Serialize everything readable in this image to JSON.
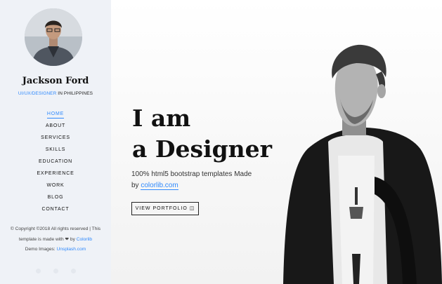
{
  "sidebar": {
    "name": "Jackson Ford",
    "role_link": "UI/UX/DESIGNER",
    "role_rest": "IN PHILIPPINES",
    "nav": [
      {
        "label": "HOME",
        "active": true
      },
      {
        "label": "ABOUT"
      },
      {
        "label": "SERVICES"
      },
      {
        "label": "SKILLS"
      },
      {
        "label": "EDUCATION"
      },
      {
        "label": "EXPERIENCE"
      },
      {
        "label": "WORK"
      },
      {
        "label": "BLOG"
      },
      {
        "label": "CONTACT"
      }
    ],
    "footer": {
      "line1": "© Copyright ©2018 All rights reserved | This",
      "line2_prefix": "template is made with",
      "line2_by": "by",
      "line2_link": "Colorlib",
      "line3_prefix": "Demo Images:",
      "line3_link": "Unsplash.com"
    }
  },
  "hero": {
    "line1": "I am",
    "line2": "a Designer",
    "desc_line1": "100% html5 bootstrap templates Made",
    "desc_by": "by",
    "desc_link": "colorlib.com",
    "button": "VIEW PORTFOLIO"
  },
  "icons": {
    "avatar": "person-photo",
    "heart": "heart-icon",
    "camera": "camera-icon"
  }
}
